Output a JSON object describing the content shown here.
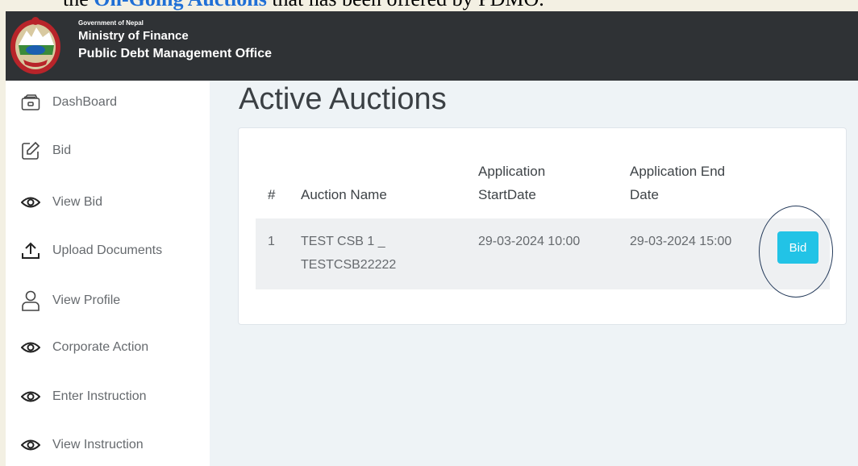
{
  "doc_caption": {
    "prefix": "the ",
    "highlight": "On-Going Auctions",
    "suffix": " that has been offered by PDMO."
  },
  "header": {
    "gov_label": "Government of Nepal",
    "ministry": "Ministry of Finance",
    "office": "Public Debt Management Office"
  },
  "sidebar": {
    "items": [
      {
        "label": "DashBoard",
        "icon": "wallet-icon"
      },
      {
        "label": "Bid",
        "icon": "edit-icon"
      },
      {
        "label": "View Bid",
        "icon": "eye-icon"
      },
      {
        "label": "Upload Documents",
        "icon": "upload-icon"
      },
      {
        "label": "View Profile",
        "icon": "user-icon"
      },
      {
        "label": "Corporate Action",
        "icon": "eye-icon"
      },
      {
        "label": "Enter Instruction",
        "icon": "eye-icon"
      },
      {
        "label": "View Instruction",
        "icon": "eye-icon"
      }
    ]
  },
  "main": {
    "title": "Active Auctions",
    "table": {
      "headers": {
        "index": "#",
        "name": "Auction Name",
        "start_line1": "Application",
        "start_line2": "StartDate",
        "end_line1": "Application End",
        "end_line2": "Date"
      },
      "rows": [
        {
          "index": "1",
          "name_line1": "TEST CSB 1 _",
          "name_line2": "TESTCSB22222",
          "start": "29-03-2024 10:00",
          "end": "29-03-2024 15:00",
          "action": "Bid"
        }
      ]
    }
  },
  "colors": {
    "header_bg": "#2f3235",
    "accent": "#22c3e6",
    "caption_highlight": "#1f6fd6"
  }
}
